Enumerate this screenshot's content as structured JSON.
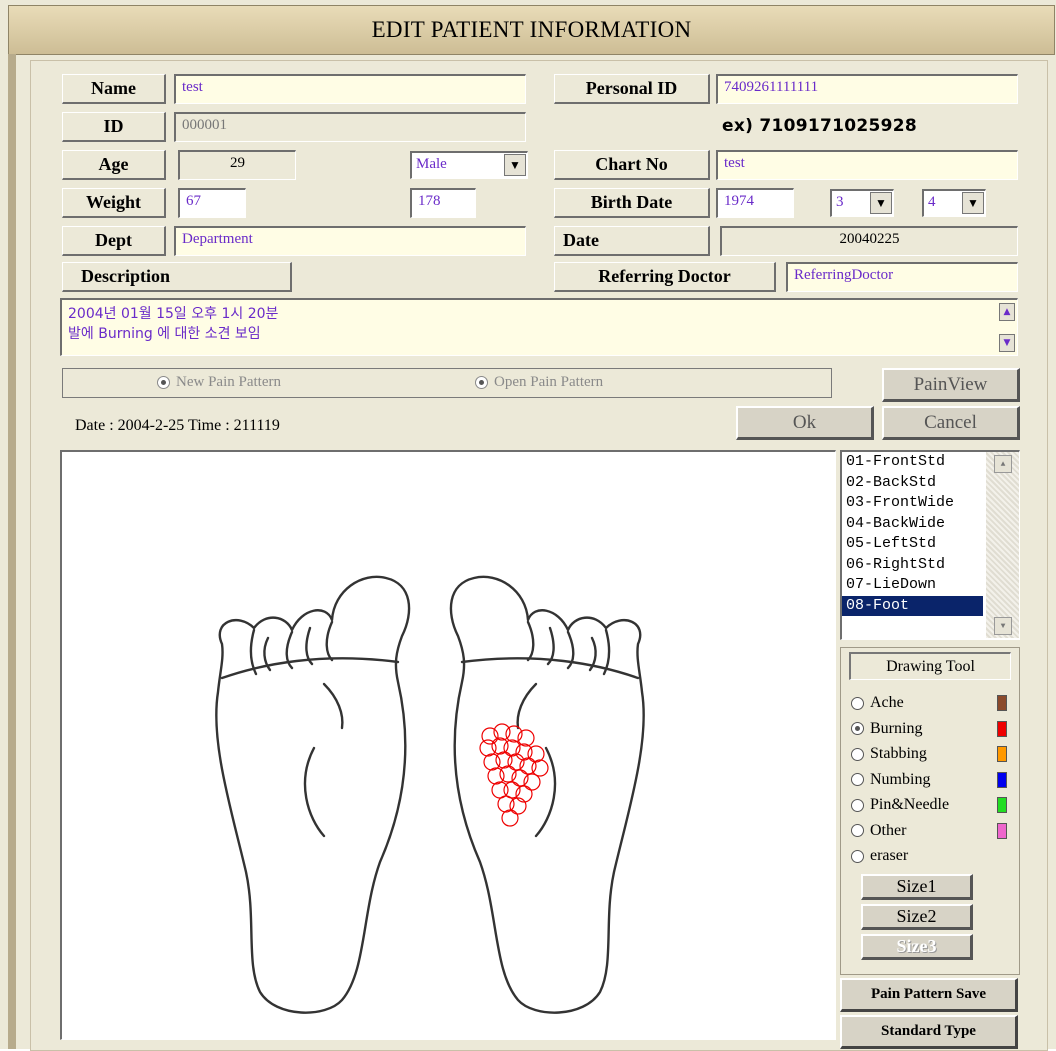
{
  "window": {
    "title": "EDIT PATIENT INFORMATION"
  },
  "fields": {
    "name_label": "Name",
    "name_value": "test",
    "id_label": "ID",
    "id_value": "000001",
    "age_label": "Age",
    "age_value": "29",
    "sex_value": "Male",
    "weight_label": "Weight",
    "weight_value": "67",
    "height_value": "178",
    "dept_label": "Dept",
    "dept_value": "Department",
    "description_label": "Description",
    "personal_id_label": "Personal ID",
    "personal_id_value": "7409261111111",
    "personal_id_hint": "ex) 7109171025928",
    "chart_no_label": "Chart No",
    "chart_no_value": "test",
    "birth_date_label": "Birth Date",
    "birth_year": "1974",
    "birth_month": "3",
    "birth_day": "4",
    "date_label": "Date",
    "date_value": "20040225",
    "referring_label": "Referring Doctor",
    "referring_value": "ReferringDoctor"
  },
  "description": {
    "line1": "2004년 01월 15일 오후 1시 20분",
    "line2": "발에 Burning 에 대한 소견 보임"
  },
  "pattern_mode": {
    "new_label": "New Pain Pattern",
    "open_label": "Open Pain Pattern",
    "selected": "New Pain Pattern"
  },
  "buttons": {
    "pain_view": "PainView",
    "ok": "Ok",
    "cancel": "Cancel",
    "pain_pattern_save": "Pain Pattern Save",
    "standard_type": "Standard Type"
  },
  "status": {
    "text": "Date : 2004-2-25   Time : 211119"
  },
  "body_views": {
    "items": [
      "01-FrontStd",
      "02-BackStd",
      "03-FrontWide",
      "04-BackWide",
      "05-LeftStd",
      "06-RightStd",
      "07-LieDown",
      "08-Foot"
    ],
    "selected": "08-Foot"
  },
  "drawing_tool": {
    "title": "Drawing Tool",
    "tools": [
      {
        "label": "Ache",
        "color": "#8b4a2b",
        "selected": false
      },
      {
        "label": "Burning",
        "color": "#ee0000",
        "selected": true
      },
      {
        "label": "Stabbing",
        "color": "#ff9900",
        "selected": false
      },
      {
        "label": "Numbing",
        "color": "#0000ee",
        "selected": false
      },
      {
        "label": "Pin&Needle",
        "color": "#22dd22",
        "selected": false
      },
      {
        "label": "Other",
        "color": "#ee66cc",
        "selected": false
      },
      {
        "label": "eraser",
        "color": "",
        "selected": false
      }
    ],
    "sizes": [
      "Size1",
      "Size2",
      "Size3"
    ]
  }
}
